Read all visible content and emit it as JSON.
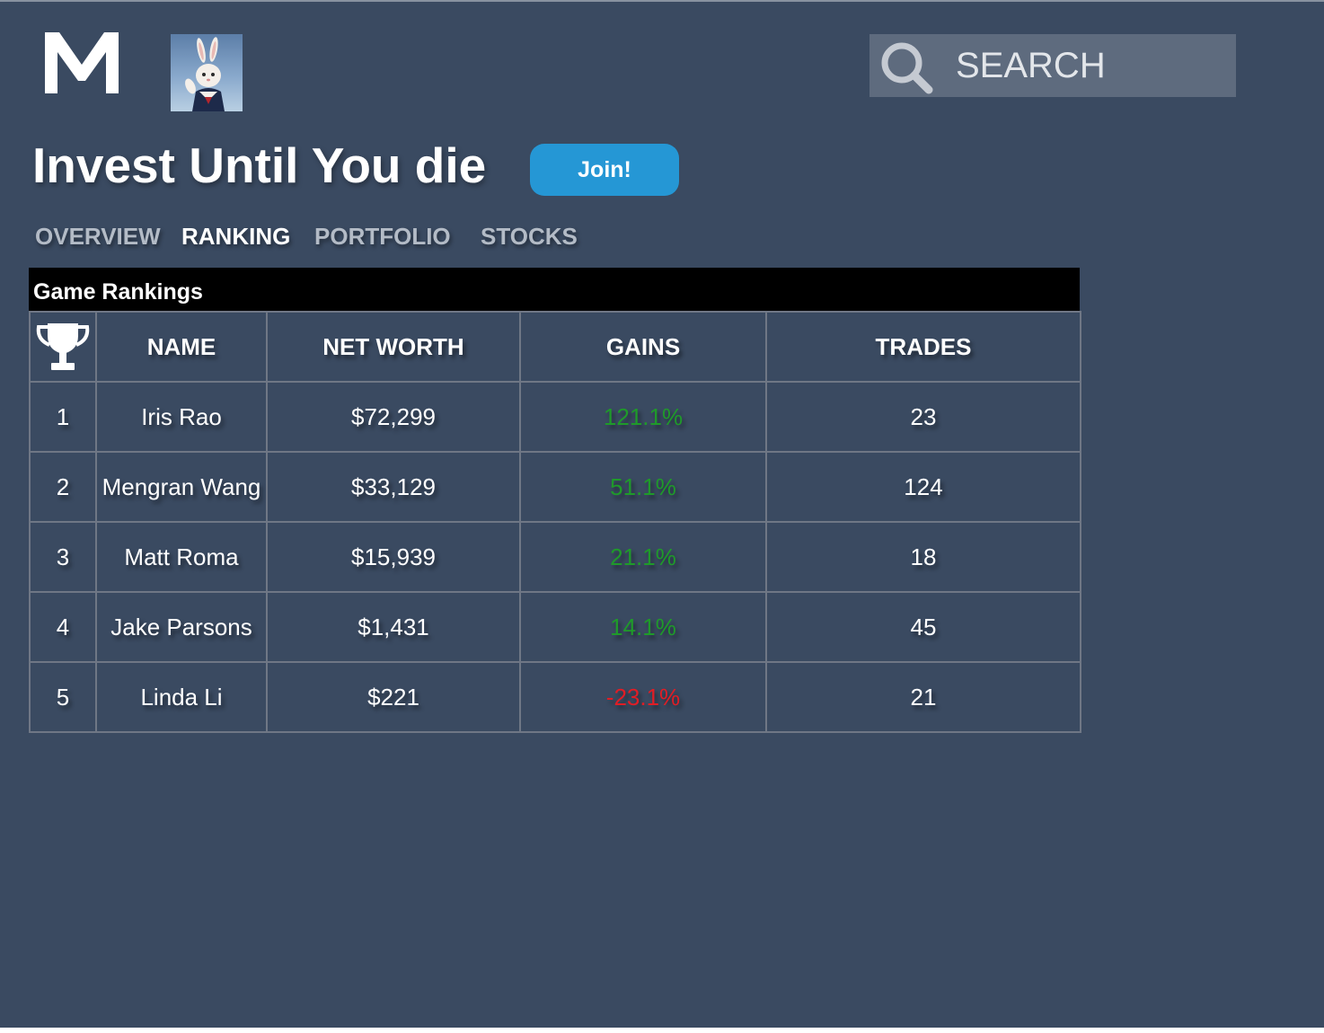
{
  "header": {
    "logo_text": "M",
    "avatar_alt": "user avatar",
    "search": {
      "placeholder": "SEARCH",
      "value": ""
    }
  },
  "game": {
    "title": "Invest Until You die",
    "join_label": "Join!"
  },
  "nav": {
    "tabs": [
      {
        "label": "OVERVIEW",
        "active": false
      },
      {
        "label": "RANKING",
        "active": true
      },
      {
        "label": "PORTFOLIO",
        "active": false
      },
      {
        "label": "STOCKS",
        "active": false
      }
    ]
  },
  "rankings": {
    "heading": "Game Rankings",
    "rank_icon": "trophy-icon",
    "columns": [
      "NAME",
      "NET WORTH",
      "GAINS",
      "TRADES"
    ],
    "rows": [
      {
        "rank": "1",
        "name": "Iris Rao",
        "net_worth": "$72,299",
        "gains": "121.1%",
        "trades": "23"
      },
      {
        "rank": "2",
        "name": "Mengran Wang",
        "net_worth": "$33,129",
        "gains": "51.1%",
        "trades": "124"
      },
      {
        "rank": "3",
        "name": "Matt Roma",
        "net_worth": "$15,939",
        "gains": "21.1%",
        "trades": "18"
      },
      {
        "rank": "4",
        "name": "Jake Parsons",
        "net_worth": "$1,431",
        "gains": "14.1%",
        "trades": "45"
      },
      {
        "rank": "5",
        "name": "Linda Li",
        "net_worth": "$221",
        "gains": "-23.1%",
        "trades": "21"
      }
    ]
  },
  "colors": {
    "background": "#3a4a61",
    "accent": "#2597d5",
    "gain_positive": "#1f9a2a",
    "gain_negative": "#e01d25"
  }
}
